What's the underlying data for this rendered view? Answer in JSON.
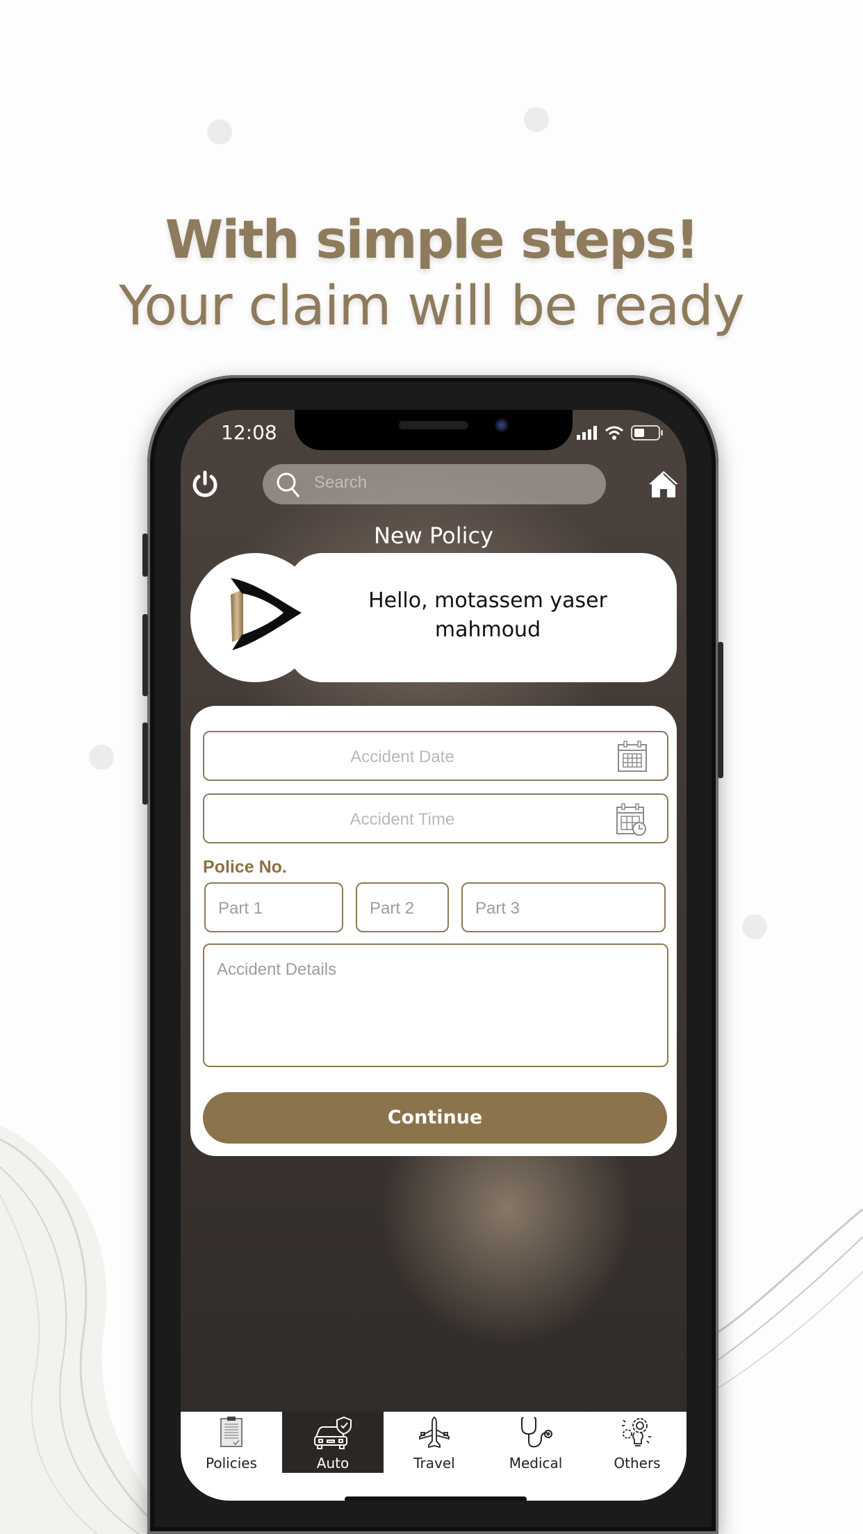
{
  "promo": {
    "headline": "With simple steps!",
    "subheadline": "Your claim will be ready"
  },
  "status_bar": {
    "time": "12:08",
    "icons": [
      "signal-icon",
      "wifi-icon",
      "battery-icon"
    ]
  },
  "top_bar": {
    "left_icon": "power-icon",
    "search_placeholder": "Search",
    "right_icon": "home-icon"
  },
  "page": {
    "title": "New Policy",
    "greeting_line1": "Hello, motassem yaser",
    "greeting_line2": "mahmoud"
  },
  "form": {
    "accident_date_placeholder": "Accident Date",
    "accident_time_placeholder": "Accident Time",
    "police_label": "Police No.",
    "part1_placeholder": "Part 1",
    "part2_placeholder": "Part 2",
    "part3_placeholder": "Part 3",
    "details_placeholder": "Accident Details",
    "continue_label": "Continue"
  },
  "tabs": [
    {
      "label": "Policies",
      "icon": "clipboard-icon",
      "active": false
    },
    {
      "label": "Auto",
      "icon": "car-shield-icon",
      "active": true
    },
    {
      "label": "Travel",
      "icon": "airplane-icon",
      "active": false
    },
    {
      "label": "Medical",
      "icon": "stethoscope-icon",
      "active": false
    },
    {
      "label": "Others",
      "icon": "lightbulb-gear-icon",
      "active": false
    }
  ],
  "colors": {
    "brand_gold": "#8b734b",
    "headline": "#8e7b5c",
    "active_tab": "#2b2725"
  }
}
